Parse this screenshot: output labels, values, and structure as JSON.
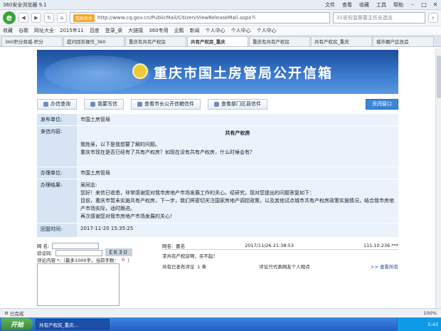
{
  "browser": {
    "title": "360安全浏览器 9.1",
    "menu": [
      "文件",
      "查看",
      "收藏",
      "工具",
      "帮助"
    ],
    "badge": "党政机关",
    "url": "http://www.cq.gov.cn/PublicMail/Citizen/ViewReleaseMail.aspx?i",
    "search_placeholder": "31省份监察委主任全选出",
    "favorites": [
      "收藏",
      "谷歌",
      "网址大全",
      "2015年11",
      "百度",
      "登录_桌",
      "大链接",
      "360专用",
      "企鹅",
      "新闻",
      "个人中心",
      "个人中心",
      "个人中心"
    ],
    "tabs": [
      {
        "label": "360积分商城-积分",
        "active": false
      },
      {
        "label": "提问回答操作_360",
        "active": false
      },
      {
        "label": "重庆有共有产权房",
        "active": false
      },
      {
        "label": "共有产权房_重庆",
        "active": true
      },
      {
        "label": "重庆有共有产权房",
        "active": false
      },
      {
        "label": "共有产权房_重庆",
        "active": false
      },
      {
        "label": "城市棚户区改造",
        "active": false
      }
    ]
  },
  "page": {
    "banner_title": "重庆市国土房管局公开信箱",
    "buttons": [
      "办信查询",
      "我要写信",
      "查看市长公开信箱信件",
      "查看部门区县信件"
    ],
    "close_label": "关闭窗口",
    "rows": {
      "unit_label": "发布单位:",
      "unit_value": "市国土房管局",
      "letter_label": "来信内容:",
      "letter_title": "共有产权房",
      "letter_lines": [
        "我姓吴，以下是我想要了解的问题。",
        "重庆市现在是否已经有了共有产权房？如现在没有共有产权房，什么时候会有？"
      ],
      "handler_label": "办理单位:",
      "handler_value": "市国土房管局",
      "result_label": "办理结果:",
      "result_lines": [
        "吴同志:",
        "您好！来信已收悉，非常感谢您对我市房地产市场发展工作的关心。经研究，现对您提出的问题答复如下：",
        "目前，重庆市暂未实施共有产权房，下一步，我们将密切关注国家房地产调控政策，以及其他试点城市共有产权房政策实施情况，结合我市房地产市场实际，适时跟进。",
        "再次感谢您对我市房地产市场发展的关心！"
      ],
      "reply_label": "回复时间:",
      "reply_value": "2017-11-20 15:35:25"
    },
    "form": {
      "name_label": "网 名:",
      "captcha_label": "验证码:",
      "captcha_text": "EK3U",
      "content_label": "评论内容 *:（最多1000字，当前字数：",
      "count": "0",
      "count_close": "）"
    },
    "comment": {
      "name_label": "网名:",
      "name_value": "匿名",
      "time": "2017/11/26 21:38:53",
      "ip": "111.10.236.***",
      "text": "求共有产权房啊，买不起！",
      "count_text": "共有已发布评论",
      "count_num": "1 条",
      "disclaimer": "评论只代表网友个人观点",
      "more": ">> 查看所有"
    }
  },
  "status": {
    "left": "已完成",
    "zoom": "100%"
  },
  "taskbar": {
    "start": "开始",
    "task": "共有产权房_重庆...",
    "time": "5:43"
  }
}
